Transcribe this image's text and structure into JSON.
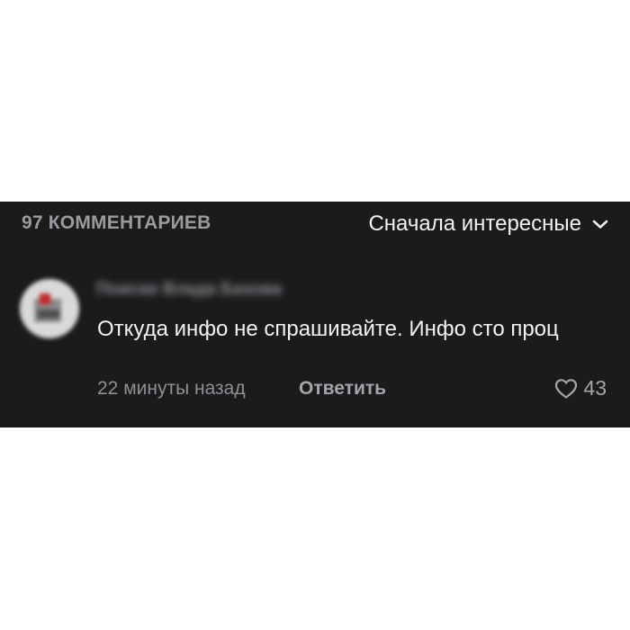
{
  "comments_header": {
    "count_label": "97 КОММЕНТАРИЕВ",
    "sort_label": "Сначала интересные",
    "sort_icon": "chevron-down-icon"
  },
  "comment": {
    "author": "Поиски Влада Бахова",
    "text": "Откуда инфо не спрашивайте. Инфо сто проц",
    "time": "22 минуты назад",
    "reply_label": "Ответить",
    "like_icon": "heart-outline-icon",
    "likes": "43"
  },
  "colors": {
    "panel_bg": "#1b1b1c",
    "primary_text": "#f2f2f4",
    "secondary_text": "#8f8f94"
  }
}
